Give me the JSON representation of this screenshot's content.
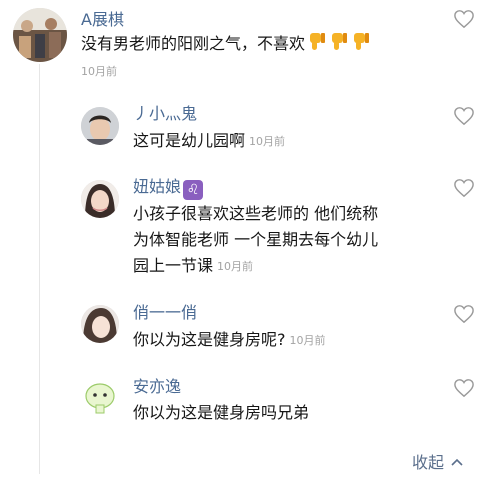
{
  "comments": [
    {
      "username": "A展棋",
      "text": "没有男老师的阳刚之气，不喜欢",
      "emoji_count": 3,
      "emoji_name": "thumbs-down-emoji",
      "time": "10月前"
    }
  ],
  "replies": [
    {
      "username": "丿小灬鬼",
      "text": "这可是幼儿园啊",
      "time": "10月前"
    },
    {
      "username": "妞姑娘",
      "badge": "♌",
      "lines": [
        "小孩子很喜欢这些老师的 他们统称",
        "为体智能老师 一个星期去每个幼儿",
        "园上一节课"
      ],
      "time": "10月前"
    },
    {
      "username": "俏一一俏",
      "text": "你以为这是健身房呢?",
      "time": "10月前"
    },
    {
      "username": "安亦逸",
      "text": "你以为这是健身房吗兄弟",
      "time": ""
    }
  ],
  "collapse_label": "收起",
  "icons": {
    "like": "heart-outline-icon",
    "collapse": "chevron-up-icon"
  },
  "colors": {
    "username": "#4a6a93",
    "time": "#a3a3a3",
    "link": "#5b6f8c"
  }
}
